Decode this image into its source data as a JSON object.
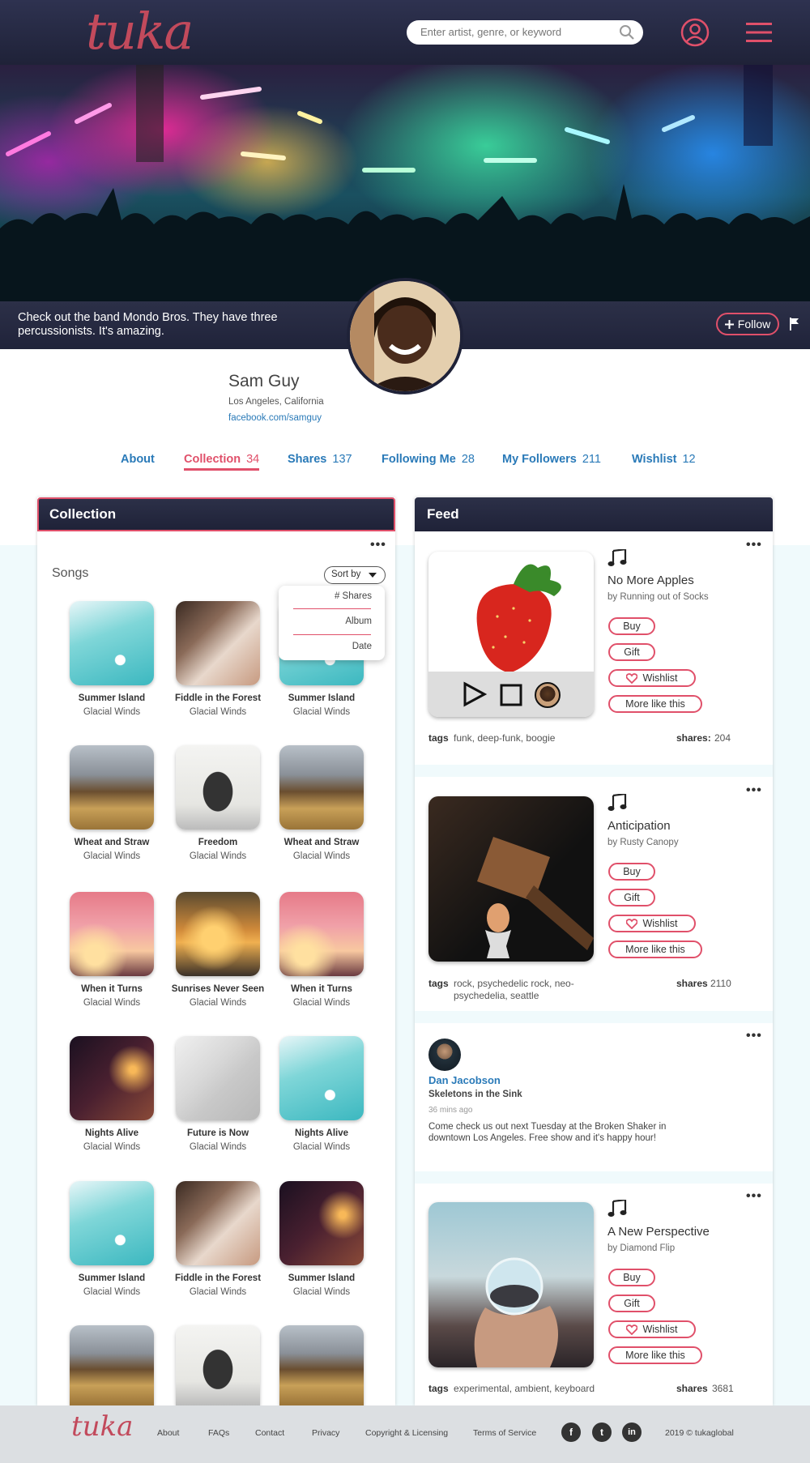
{
  "header": {
    "logo": "tuka",
    "search_placeholder": "Enter artist, genre, or keyword"
  },
  "hero": {
    "message": "Check out the band Mondo Bros. They have three percussionists. It's amazing.",
    "follow_label": "Follow"
  },
  "profile": {
    "name": "Sam Guy",
    "location": "Los Angeles, California",
    "link": "facebook.com/samguy"
  },
  "tabs": [
    {
      "label": "About",
      "count": ""
    },
    {
      "label": "Collection",
      "count": "34"
    },
    {
      "label": "Shares",
      "count": "137"
    },
    {
      "label": "Following Me",
      "count": "28"
    },
    {
      "label": "My Followers",
      "count": "211"
    },
    {
      "label": "Wishlist",
      "count": "12"
    }
  ],
  "collection": {
    "title": "Collection",
    "songs_heading": "Songs",
    "sort_label": "Sort by",
    "sort_options": [
      "# Shares",
      "Album",
      "Date"
    ],
    "songs": [
      {
        "title": "Summer Island",
        "artist": "Glacial Winds"
      },
      {
        "title": "Fiddle in the Forest",
        "artist": "Glacial Winds"
      },
      {
        "title": "Summer Island",
        "artist": "Glacial Winds"
      },
      {
        "title": "Wheat and Straw",
        "artist": "Glacial Winds"
      },
      {
        "title": "Freedom",
        "artist": "Glacial Winds"
      },
      {
        "title": "Wheat and Straw",
        "artist": "Glacial Winds"
      },
      {
        "title": "When it Turns",
        "artist": "Glacial Winds"
      },
      {
        "title": "Sunrises Never Seen",
        "artist": "Glacial Winds"
      },
      {
        "title": "When it Turns",
        "artist": "Glacial Winds"
      },
      {
        "title": "Nights Alive",
        "artist": "Glacial Winds"
      },
      {
        "title": "Future is Now",
        "artist": "Glacial Winds"
      },
      {
        "title": "Nights Alive",
        "artist": "Glacial Winds"
      },
      {
        "title": "Summer Island",
        "artist": "Glacial Winds"
      },
      {
        "title": "Fiddle in the Forest",
        "artist": "Glacial Winds"
      },
      {
        "title": "Summer Island",
        "artist": "Glacial Winds"
      }
    ]
  },
  "feed": {
    "title": "Feed",
    "buttons": {
      "buy": "Buy",
      "gift": "Gift",
      "wishlist": "Wishlist",
      "more": "More like this"
    },
    "tags_label": "tags",
    "shares_label": "shares",
    "items": [
      {
        "title": "No More Apples",
        "by": "by Running out of Socks",
        "tags": "funk, deep-funk, boogie",
        "shares_label": "shares:",
        "shares": "204"
      },
      {
        "title": "Anticipation",
        "by": "by Rusty Canopy",
        "tags": "rock, psychedelic rock, neo-psychedelia, seattle",
        "shares_label": "shares",
        "shares": "2110"
      },
      {
        "title": "A New Perspective",
        "by": "by Diamond Flip",
        "tags": "experimental, ambient, keyboard",
        "shares_label": "shares",
        "shares": "3681"
      }
    ],
    "post": {
      "user": "Dan Jacobson",
      "subtitle": "Skeletons in the Sink",
      "time": "36 mins ago",
      "text": "Come check us out next Tuesday at the Broken Shaker in downtown Los Angeles. Free show and it's happy hour!"
    }
  },
  "footer": {
    "logo": "tuka",
    "links": [
      "About",
      "FAQs",
      "Contact",
      "Privacy",
      "Copyright & Licensing",
      "Terms of Service"
    ],
    "social": [
      "f",
      "t",
      "in"
    ],
    "copyright": "2019 © tukaglobal"
  },
  "colors": {
    "accent": "#e0506a",
    "header": "#1f2238",
    "link": "#2a7ab8"
  }
}
